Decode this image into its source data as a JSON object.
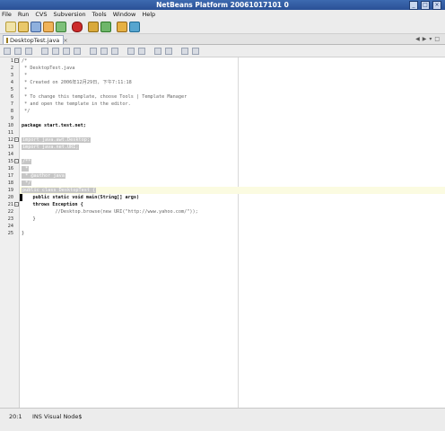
{
  "window": {
    "title": "NetBeans Platform 20061017101 0"
  },
  "menu": [
    "File",
    "Run",
    "CVS",
    "Subversion",
    "Tools",
    "Window",
    "Help"
  ],
  "toolbar": {
    "icons": [
      "new-file-icon",
      "open-project-icon",
      "save-icon",
      "back-icon",
      "forward-icon",
      "run-icon",
      "debug-icon",
      "build-icon",
      "profile-icon",
      "vis-icon"
    ]
  },
  "tab": {
    "label": "DesktopTest.java"
  },
  "editor_toolbar": {
    "icons": [
      "toggle-icon",
      "back-icon",
      "forward-icon",
      "find-icon",
      "find-prev-icon",
      "find-next-icon",
      "search-icon",
      "bookmark-icon",
      "prev-bookmark-icon",
      "next-bookmark-icon",
      "shift-left-icon",
      "shift-right-icon",
      "macro-record-icon",
      "macro-stop-icon",
      "uncomment-icon",
      "comment-icon"
    ]
  },
  "code": {
    "lines": [
      {
        "n": "1",
        "text": "/*"
      },
      {
        "n": "2",
        "text": " * DesktopTest.java"
      },
      {
        "n": "3",
        "text": " *"
      },
      {
        "n": "4",
        "text": " * Created on 2006年12月29日, 下午7:11:18"
      },
      {
        "n": "5",
        "text": " *"
      },
      {
        "n": "6",
        "text": " * To change this template, choose Tools | Template Manager"
      },
      {
        "n": "7",
        "text": " * and open the template in the editor."
      },
      {
        "n": "8",
        "text": " */"
      },
      {
        "n": "9",
        "text": ""
      },
      {
        "n": "10",
        "text": "package start.test.net;"
      },
      {
        "n": "11",
        "text": ""
      },
      {
        "n": "12",
        "text": "import java.awt.Desktop;"
      },
      {
        "n": "13",
        "text": "import java.net.URI;"
      },
      {
        "n": "14",
        "text": ""
      },
      {
        "n": "15",
        "text": "/**"
      },
      {
        "n": "16",
        "text": " *"
      },
      {
        "n": "17",
        "text": " * @author java"
      },
      {
        "n": "18",
        "text": " */"
      },
      {
        "n": "19",
        "text": "public class DesktopTest {"
      },
      {
        "n": "20",
        "text": "    public static void main(String[] args)"
      },
      {
        "n": "21",
        "text": "    throws Exception {"
      },
      {
        "n": "22",
        "text": "            //Desktop.browse(new URI(\"http://www.yahoo.com/\"));"
      },
      {
        "n": "23",
        "text": "    }"
      },
      {
        "n": "24",
        "text": ""
      },
      {
        "n": "25",
        "text": "}"
      }
    ]
  },
  "status": {
    "position": "20:1",
    "mode": "INS  Visual Node$"
  }
}
